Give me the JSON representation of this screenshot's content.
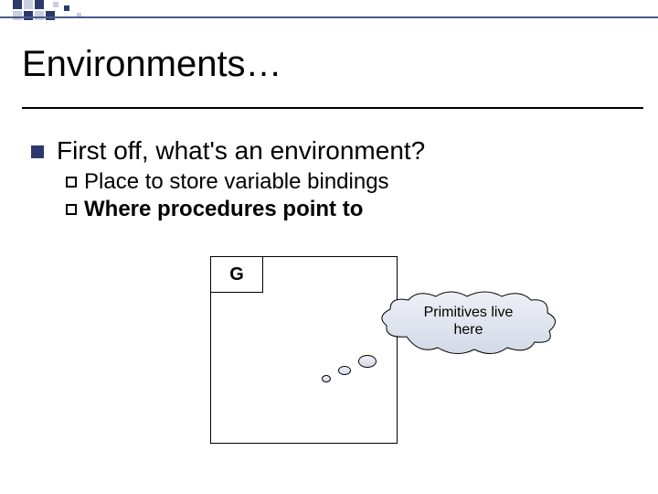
{
  "title": "Environments…",
  "bullet1": "First off, what's an environment?",
  "sub1_prefix": "Place",
  "sub1_rest": " to store variable bindings",
  "sub2_prefix": "Where",
  "sub2_rest": " procedures point to",
  "env_label": "G",
  "cloud_line1": "Primitives live",
  "cloud_line2": "here",
  "colors": {
    "navy": "#2b3a6b",
    "mid": "#4a5a8a",
    "light": "#c9cee0"
  }
}
